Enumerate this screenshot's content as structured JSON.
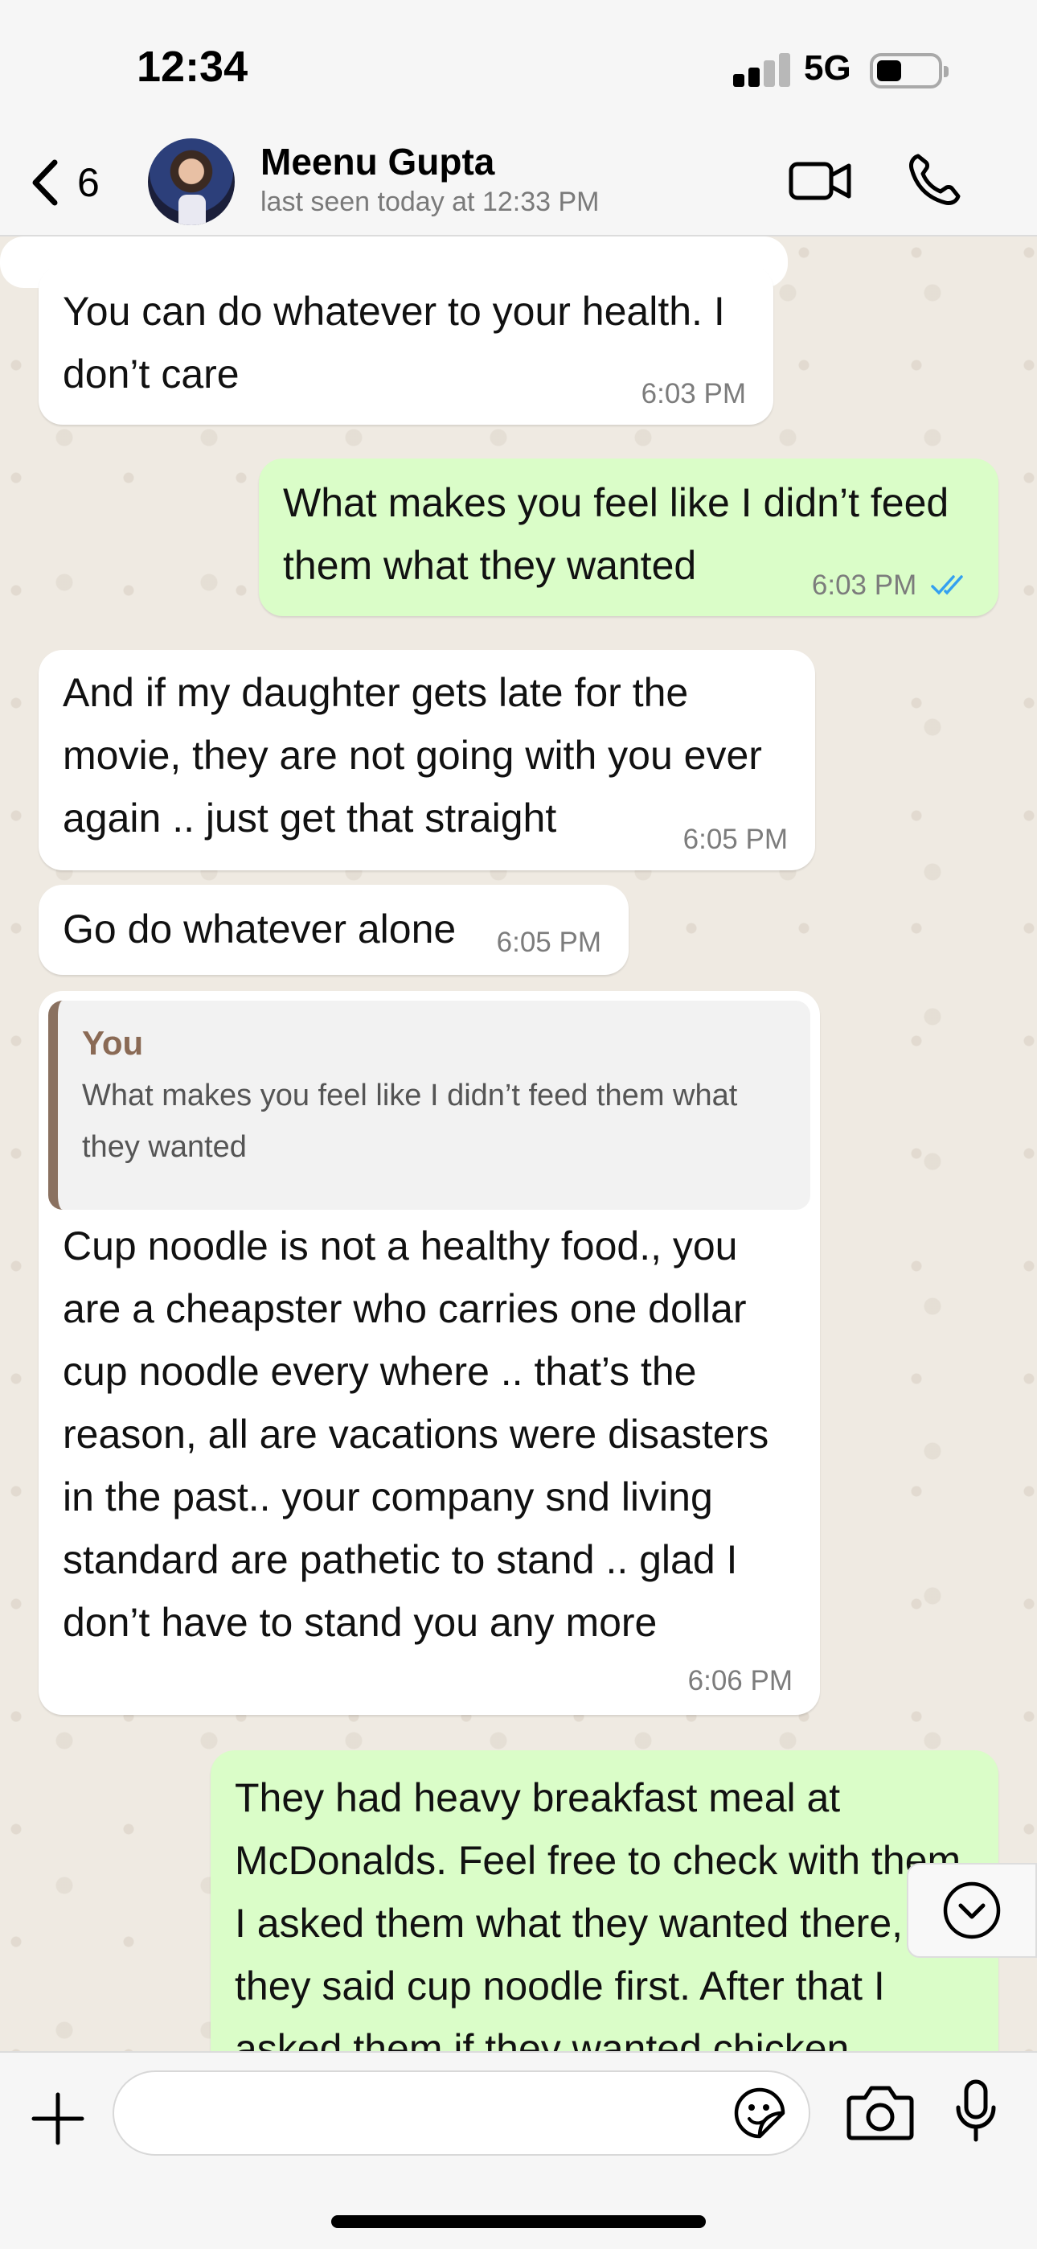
{
  "status_bar": {
    "time": "12:34",
    "network": "5G"
  },
  "header": {
    "back_count": "6",
    "contact_name": "Meenu Gupta",
    "last_seen": "last seen today at 12:33 PM"
  },
  "messages": [
    {
      "direction": "incoming",
      "text": "You can do whatever to your health. I don’t care",
      "time": "6:03 PM"
    },
    {
      "direction": "outgoing",
      "text": "What makes you feel like I didn’t feed them what they wanted",
      "time": "6:03 PM",
      "read": true
    },
    {
      "direction": "incoming",
      "text": "And if my daughter gets late for the movie, they are not going with you ever again .. just get that straight",
      "time": "6:05 PM"
    },
    {
      "direction": "incoming",
      "text": "Go do whatever alone",
      "time": "6:05 PM"
    },
    {
      "direction": "incoming",
      "quoted_author": "You",
      "quoted_text": "What makes you feel like I didn’t feed them what they wanted",
      "text": "Cup noodle is not a healthy food., you are a cheapster who carries one dollar cup noodle every where .. that’s the reason, all are vacations were disasters in the past.. your company snd living standard are pathetic to stand .. glad I don’t have to stand you any more",
      "time": "6:06 PM"
    },
    {
      "direction": "outgoing",
      "text": "They had heavy breakfast meal at McDonalds. Feel free to check with them. I asked them what they wanted there, they said cup noodle first. After that I asked them if they wanted chicken"
    }
  ],
  "composer": {
    "input_value": ""
  },
  "colors": {
    "incoming_bubble": "#ffffff",
    "outgoing_bubble": "#dafdc8",
    "read_ticks": "#34a0f0",
    "quote_bar": "#8a7160"
  },
  "icons": [
    "back-chevron-icon",
    "video-call-icon",
    "phone-call-icon",
    "scroll-down-icon",
    "plus-icon",
    "sticker-icon",
    "camera-icon",
    "microphone-icon",
    "read-ticks-icon"
  ]
}
